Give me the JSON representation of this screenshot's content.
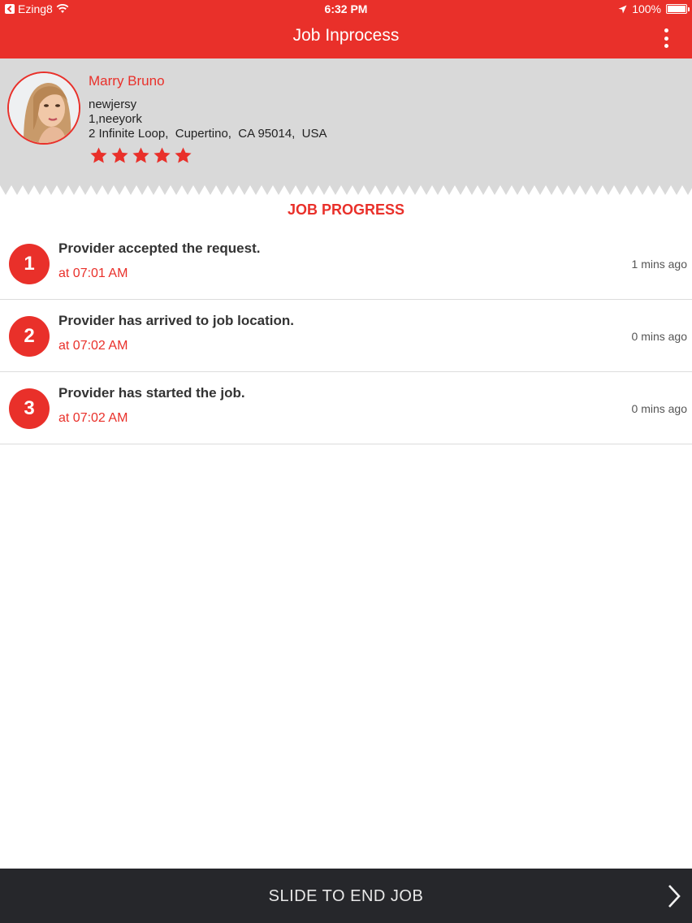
{
  "status_bar": {
    "carrier": "Ezing8",
    "time": "6:32 PM",
    "battery": "100%",
    "battery_level": 1.0
  },
  "nav": {
    "title": "Job Inprocess",
    "menu_icon": "more-vertical-icon"
  },
  "profile": {
    "name": "Marry Bruno",
    "address_lines": [
      "newjersy",
      "1,neeyork",
      "2 Infinite Loop,  Cupertino,  CA 95014,  USA"
    ],
    "rating": 5,
    "rating_max": 5
  },
  "progress": {
    "title": "JOB PROGRESS",
    "items": [
      {
        "number": "1",
        "title": "Provider accepted the request.",
        "time": "at 07:01 AM",
        "ago": "1 mins ago"
      },
      {
        "number": "2",
        "title": "Provider has arrived to job location.",
        "time": "at 07:02 AM",
        "ago": "0 mins ago"
      },
      {
        "number": "3",
        "title": "Provider has started the job.",
        "time": "at 07:02 AM",
        "ago": "0 mins ago"
      }
    ]
  },
  "slide": {
    "label": "SLIDE TO END JOB",
    "icon": "chevron-right-icon"
  },
  "colors": {
    "accent": "#e9302a",
    "header_bg": "#d9d9d9",
    "slide_bg": "#26272b"
  }
}
